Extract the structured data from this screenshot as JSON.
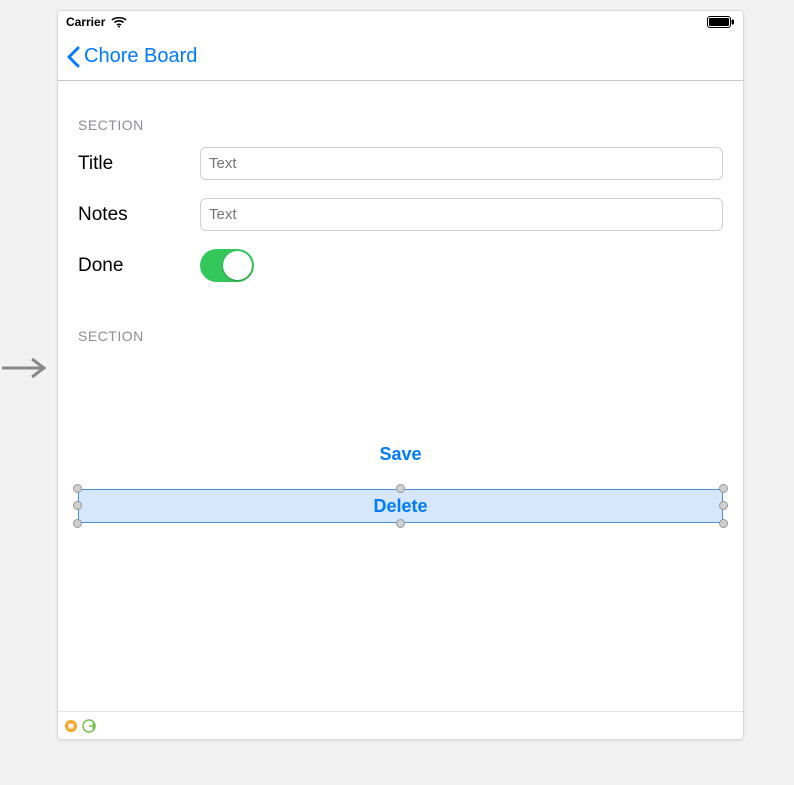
{
  "status_bar": {
    "carrier": "Carrier"
  },
  "nav": {
    "back_label": "Chore Board"
  },
  "section1": {
    "header": "SECTION",
    "title_label": "Title",
    "title_placeholder": "Text",
    "title_value": "",
    "notes_label": "Notes",
    "notes_placeholder": "Text",
    "notes_value": "",
    "done_label": "Done",
    "done_value": true
  },
  "section2": {
    "header": "SECTION",
    "save_label": "Save",
    "delete_label": "Delete"
  }
}
